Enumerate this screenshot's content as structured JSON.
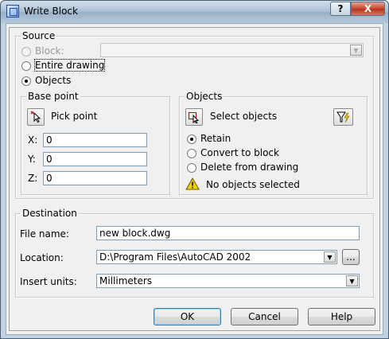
{
  "window": {
    "title": "Write Block",
    "help_btn": "?",
    "close_btn": "X"
  },
  "source": {
    "title": "Source",
    "block_label": "Block:",
    "block_value": "",
    "entire_label": "Entire drawing",
    "objects_label": "Objects",
    "selected": "objects"
  },
  "base_point": {
    "title": "Base point",
    "pick_label": "Pick point",
    "x_label": "X:",
    "x_value": "0",
    "y_label": "Y:",
    "y_value": "0",
    "z_label": "Z:",
    "z_value": "0"
  },
  "objects": {
    "title": "Objects",
    "select_label": "Select objects",
    "retain_label": "Retain",
    "convert_label": "Convert to block",
    "delete_label": "Delete from drawing",
    "status": "No objects selected",
    "selected": "retain"
  },
  "destination": {
    "title": "Destination",
    "file_label": "File name:",
    "file_value": "new block.dwg",
    "location_label": "Location:",
    "location_value": "D:\\Program Files\\AutoCAD 2002",
    "browse_label": "...",
    "units_label": "Insert units:",
    "units_value": "Millimeters"
  },
  "buttons": {
    "ok": "OK",
    "cancel": "Cancel",
    "help": "Help"
  },
  "icons": {
    "app": "block-icon",
    "pick": "pick-point-icon",
    "select": "select-objects-icon",
    "filter": "quick-select-icon",
    "warning": "warning-icon"
  }
}
